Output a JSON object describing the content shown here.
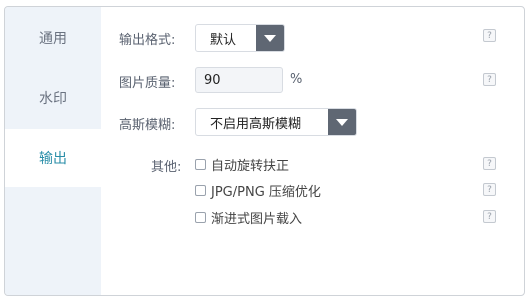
{
  "sidebar": {
    "items": [
      {
        "label": "通用",
        "active": false
      },
      {
        "label": "水印",
        "active": false
      },
      {
        "label": "输出",
        "active": true
      }
    ]
  },
  "form": {
    "output_format": {
      "label": "输出格式:",
      "value": "默认"
    },
    "quality": {
      "label": "图片质量:",
      "value": "90",
      "unit": "%"
    },
    "gaussian": {
      "label": "高斯模糊:",
      "value": "不启用高斯模糊"
    },
    "other": {
      "label": "其他:",
      "options": [
        {
          "label": "自动旋转扶正",
          "checked": false
        },
        {
          "label": "JPG/PNG 压缩优化",
          "checked": false
        },
        {
          "label": "渐进式图片载入",
          "checked": false
        }
      ]
    },
    "help_glyph": "?"
  },
  "colors": {
    "accent": "#2a8ea8",
    "sidebar_bg": "#eef3f9",
    "arrow_bg": "#5f6773"
  }
}
